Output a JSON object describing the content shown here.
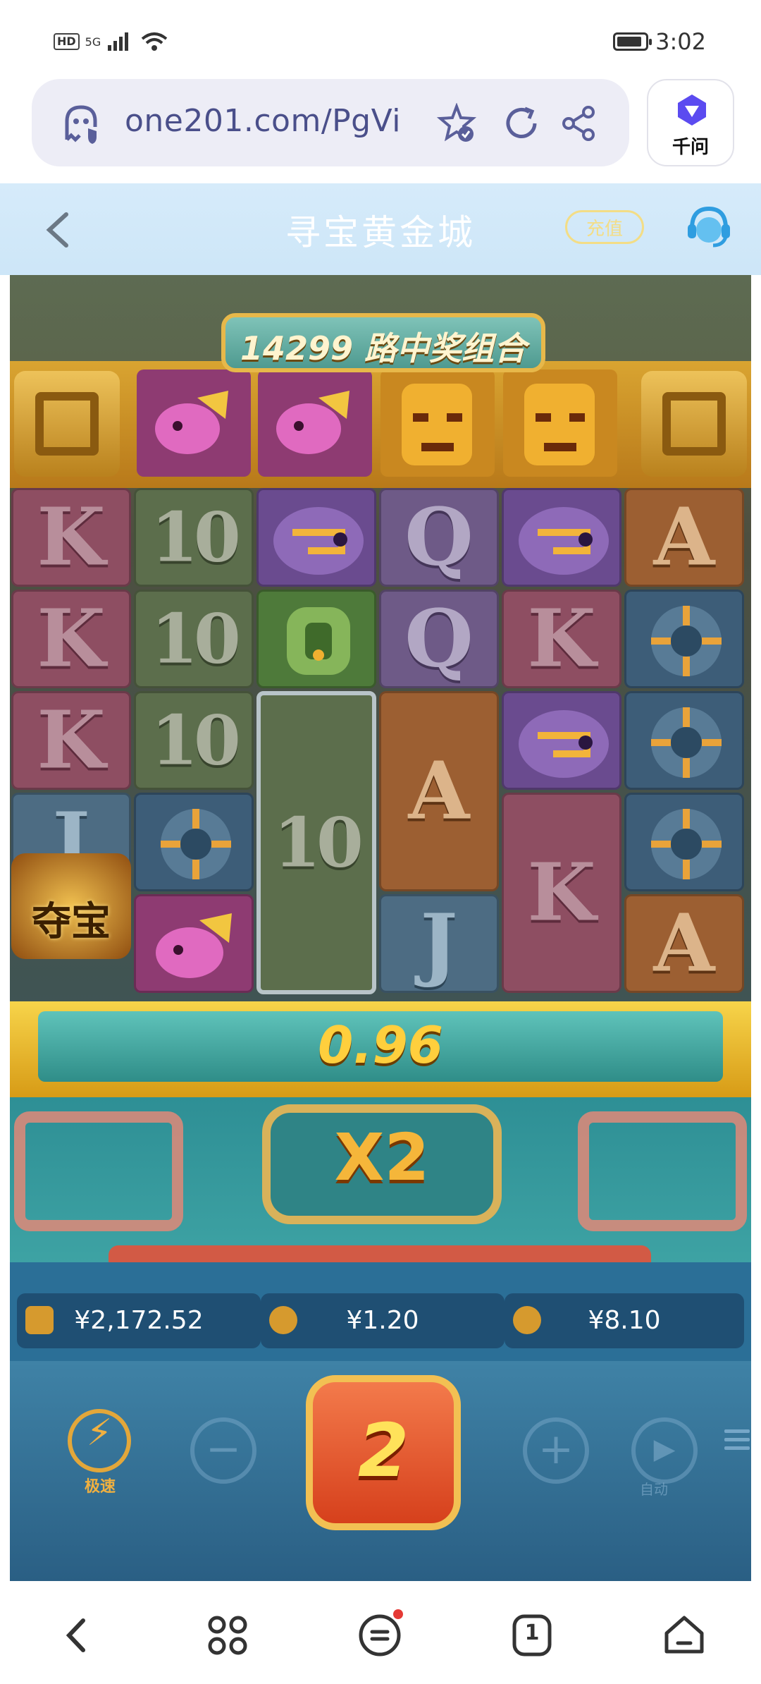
{
  "status_bar": {
    "hd": "HD",
    "network": "5G",
    "time": "3:02"
  },
  "browser": {
    "url": "one201.com/PgVi",
    "assistant_label": "千问",
    "icons": [
      "ghost-shield-icon",
      "star-check-icon",
      "refresh-icon",
      "share-icon",
      "qianwen-logo-icon"
    ]
  },
  "app_header": {
    "title": "寻宝黄金城",
    "recharge_label": "充值",
    "icons": [
      "back-arrow-icon",
      "customer-service-icon"
    ]
  },
  "game": {
    "ways_banner": "14299 路中奖组合",
    "top_reel": [
      "pink-bird",
      "pink-bird",
      "gold-mask",
      "gold-mask"
    ],
    "reels": [
      [
        "K",
        "K",
        "K",
        "J",
        "treasure-wild"
      ],
      [
        "10",
        "10",
        "10",
        "compass",
        "pink-bird"
      ],
      [
        "purple-serpent",
        "green-jade",
        "10"
      ],
      [
        "Q",
        "Q",
        "A",
        "J"
      ],
      [
        "purple-serpent",
        "K",
        "purple-serpent",
        "K"
      ],
      [
        "A",
        "compass",
        "compass",
        "compass",
        "A"
      ]
    ],
    "treasure_label": "夺宝",
    "win_amount": "0.96",
    "multiplier": "X2",
    "balance": "¥2,172.52",
    "bet": "¥1.20",
    "win": "¥8.10",
    "turbo_label": "极速",
    "spin_count": "2",
    "auto_label": "自动",
    "minus": "−",
    "plus": "+"
  },
  "nav_bar": {
    "icons": [
      "back-icon",
      "apps-icon",
      "menu-icon",
      "tabs-icon",
      "home-icon"
    ],
    "tab_count": "1"
  }
}
